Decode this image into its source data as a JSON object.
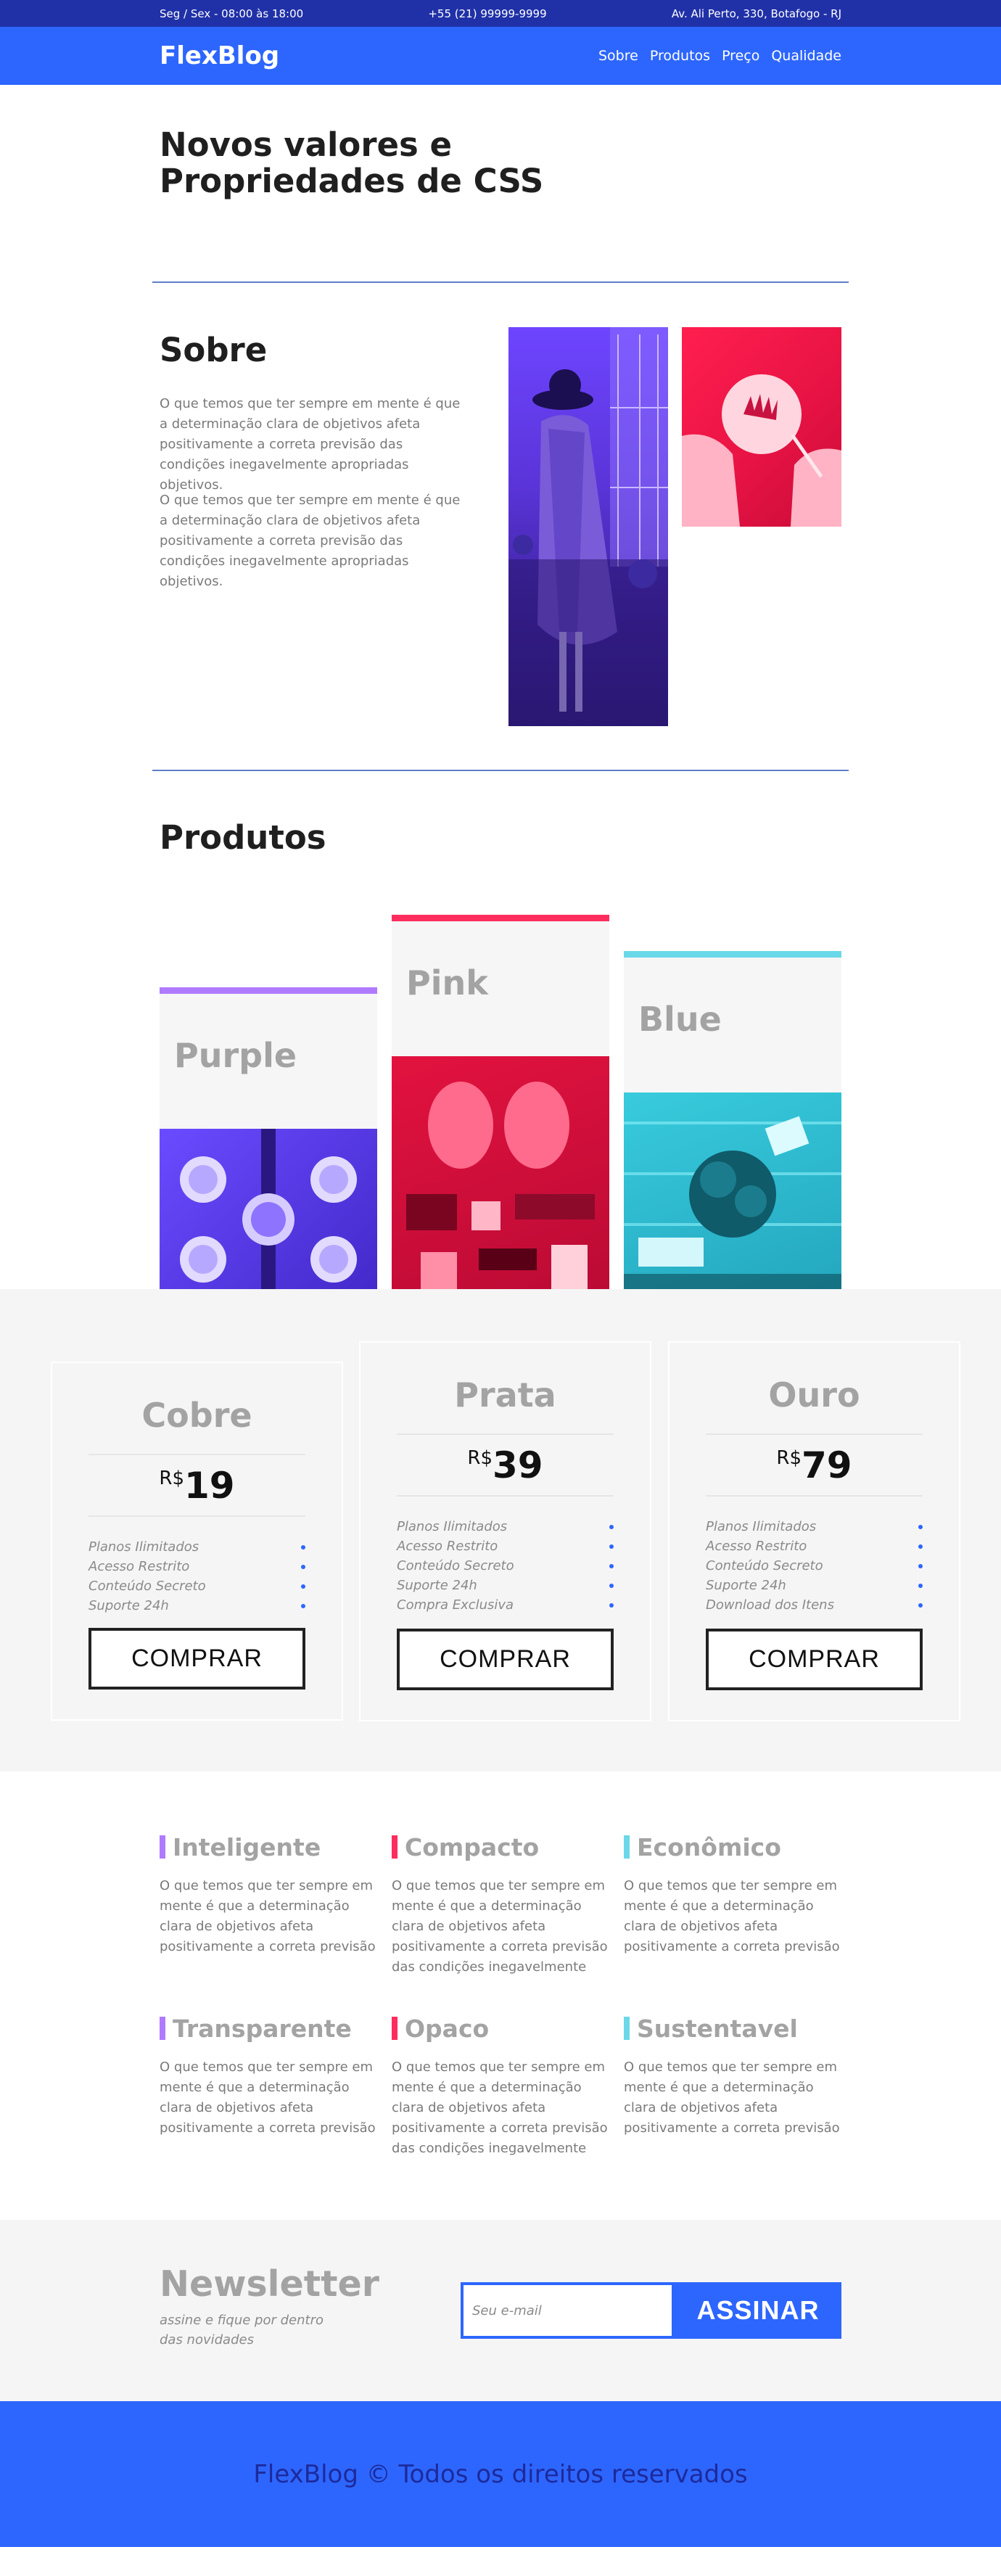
{
  "topbar": {
    "hours": "Seg / Sex - 08:00 às 18:00",
    "phone": "+55 (21) 99999-9999",
    "address": "Av. Ali Perto, 330, Botafogo - RJ"
  },
  "header": {
    "logo": "FlexBlog",
    "nav": [
      "Sobre",
      "Produtos",
      "Preço",
      "Qualidade"
    ]
  },
  "intro": {
    "title": "Novos valores e Propriedades de CSS"
  },
  "sobre": {
    "title": "Sobre",
    "paragraphs": [
      "O que temos que ter sempre em mente é que a determinação clara de objetivos afeta positivamente a correta previsão das condições inegavelmente apropriadas objetivos.",
      "O que temos que ter sempre em mente é que a determinação clara de objetivos afeta positivamente a correta previsão das condições inegavelmente apropriadas objetivos."
    ]
  },
  "produtos": {
    "title": "Produtos",
    "items": [
      {
        "name": "Purple",
        "color": "#b07aff"
      },
      {
        "name": "Pink",
        "color": "#ff2d5d"
      },
      {
        "name": "Blue",
        "color": "#6ad8e8"
      }
    ]
  },
  "plans": [
    {
      "name": "Cobre",
      "currency": "R$",
      "price": "19",
      "features": [
        "Planos Ilimitados",
        "Acesso Restrito",
        "Conteúdo Secreto",
        "Suporte 24h"
      ],
      "button": "COMPRAR"
    },
    {
      "name": "Prata",
      "currency": "R$",
      "price": "39",
      "features": [
        "Planos Ilimitados",
        "Acesso Restrito",
        "Conteúdo Secreto",
        "Suporte 24h",
        "Compra Exclusiva"
      ],
      "button": "COMPRAR"
    },
    {
      "name": "Ouro",
      "currency": "R$",
      "price": "79",
      "features": [
        "Planos Ilimitados",
        "Acesso Restrito",
        "Conteúdo Secreto",
        "Suporte 24h",
        "Download dos Itens"
      ],
      "button": "COMPRAR"
    }
  ],
  "features": [
    {
      "title": "Inteligente",
      "text": "O que temos que ter sempre em mente é que a determinação clara de objetivos afeta positivamente a correta previsão"
    },
    {
      "title": "Compacto",
      "text": "O que temos que ter sempre em mente é que a determinação clara de objetivos afeta positivamente a correta previsão das condições inegavelmente"
    },
    {
      "title": "Econômico",
      "text": "O que temos que ter sempre em mente é que a determinação clara de objetivos afeta positivamente a correta previsão"
    },
    {
      "title": "Transparente",
      "text": "O que temos que ter sempre em mente é que a determinação clara de objetivos afeta positivamente a correta previsão"
    },
    {
      "title": "Opaco",
      "text": "O que temos que ter sempre em mente é que a determinação clara de objetivos afeta positivamente a correta previsão das condições inegavelmente"
    },
    {
      "title": "Sustentavel",
      "text": "O que temos que ter sempre em mente é que a determinação clara de objetivos afeta positivamente a correta previsão"
    }
  ],
  "newsletter": {
    "title": "Newsletter",
    "subtitle": "assine e fique por dentro das novidades",
    "placeholder": "Seu e-mail",
    "button": "ASSINAR"
  },
  "footer": {
    "text": "FlexBlog © Todos os direitos reservados"
  },
  "colors": {
    "brand": "#2d66ff",
    "topbar": "#2031a8",
    "purple": "#b07aff",
    "pink": "#ff2d5d",
    "blue": "#6ad8e8"
  }
}
